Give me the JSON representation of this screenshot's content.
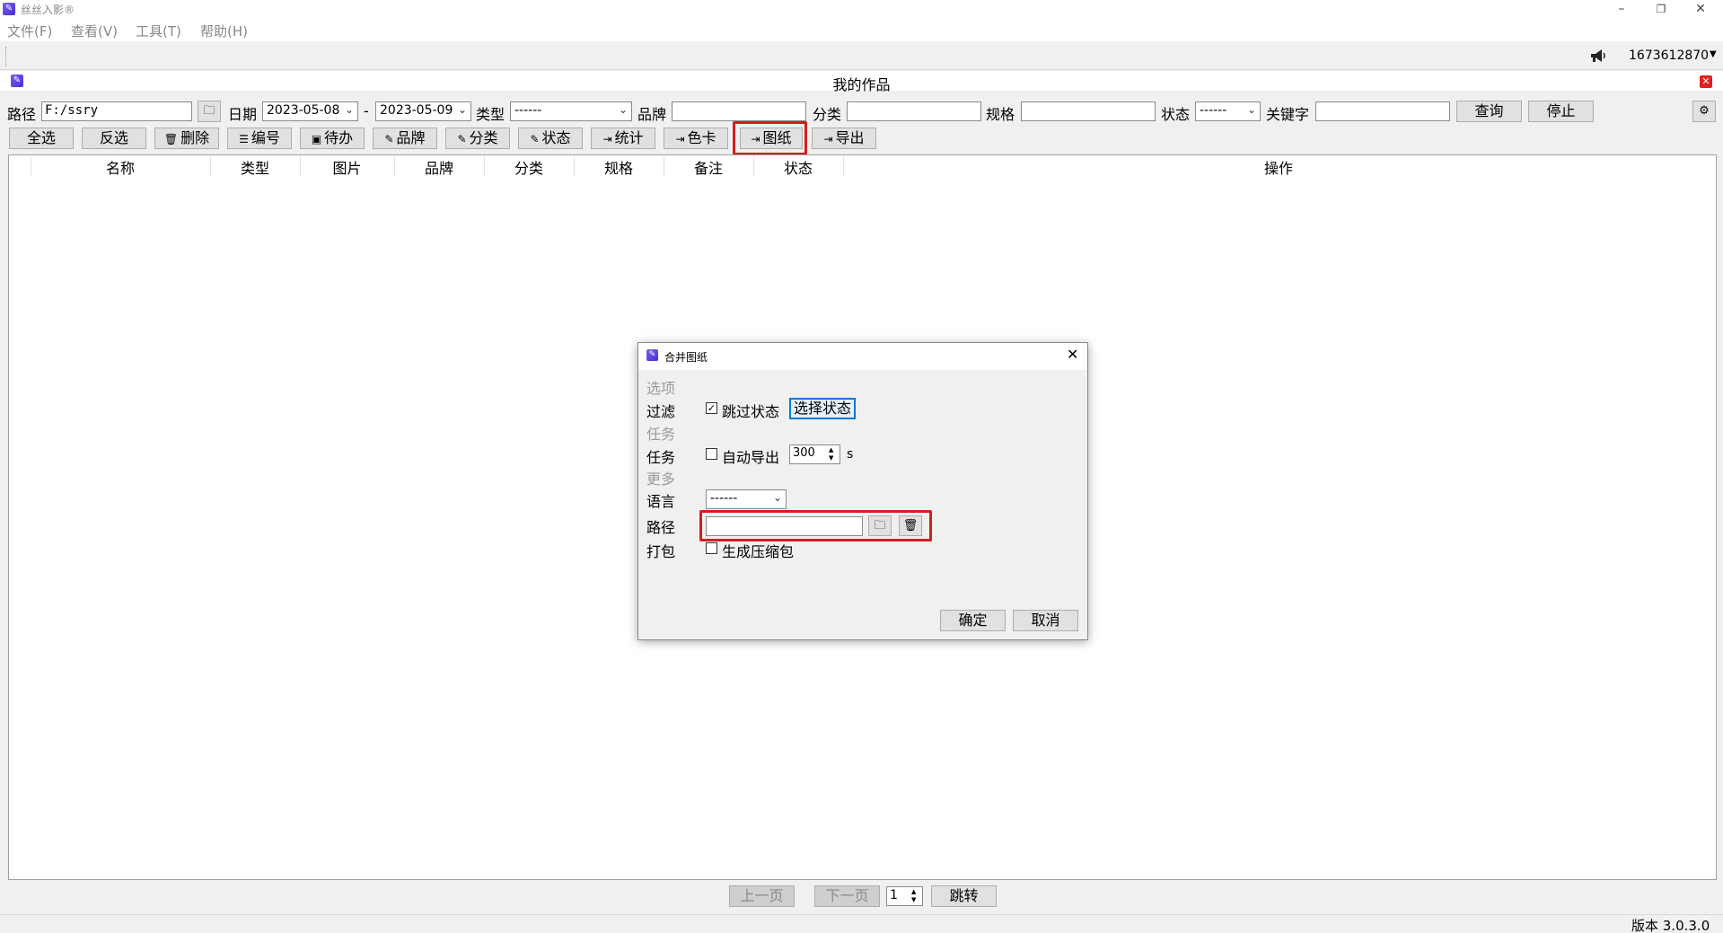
{
  "window": {
    "title": "丝丝入影®",
    "controls": {
      "minimize": "–",
      "restore": "❐",
      "close": "✕"
    }
  },
  "menu": [
    "文件(F)",
    "查看(V)",
    "工具(T)",
    "帮助(H)"
  ],
  "account": {
    "id": "1673612870"
  },
  "inner": {
    "title": "我的作品",
    "close": "✕"
  },
  "filters": {
    "path_label": "路径",
    "path_value": "F:/ssry",
    "date_label": "日期",
    "date_from": "2023-05-08",
    "date_sep": "-",
    "date_to": "2023-05-09",
    "type_label": "类型",
    "type_value": "------",
    "brand_label": "品牌",
    "brand_value": "",
    "category_label": "分类",
    "category_value": "",
    "spec_label": "规格",
    "spec_value": "",
    "status_label": "状态",
    "status_value": "------",
    "keyword_label": "关键字",
    "keyword_value": "",
    "query": "查询",
    "stop": "停止"
  },
  "actions": {
    "select_all": "全选",
    "invert": "反选",
    "delete": "删除",
    "number": "编号",
    "todo": "待办",
    "brand": "品牌",
    "category": "分类",
    "status": "状态",
    "stats": "统计",
    "color_card": "色卡",
    "drawing": "图纸",
    "export": "导出"
  },
  "table": {
    "columns": [
      "名称",
      "类型",
      "图片",
      "品牌",
      "分类",
      "规格",
      "备注",
      "状态",
      "操作"
    ]
  },
  "pager": {
    "prev": "上一页",
    "next": "下一页",
    "page": "1",
    "jump": "跳转"
  },
  "status_bar": {
    "version": "版本 3.0.3.0"
  },
  "dialog": {
    "title": "合并图纸",
    "section_options": "选项",
    "filter_label": "过滤",
    "skip_status": "跳过状态",
    "skip_status_checked": true,
    "select_status": "选择状态",
    "section_task": "任务",
    "task_label": "任务",
    "auto_export": "自动导出",
    "auto_export_checked": false,
    "interval": "300",
    "interval_unit": "s",
    "section_more": "更多",
    "language_label": "语言",
    "language_value": "------",
    "path_label": "路径",
    "path_value": "",
    "pack_label": "打包",
    "make_zip": "生成压缩包",
    "make_zip_checked": false,
    "ok": "确定",
    "cancel": "取消"
  }
}
